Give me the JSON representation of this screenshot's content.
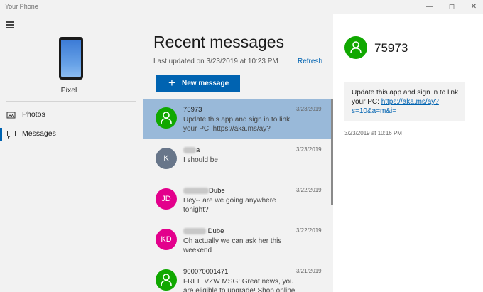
{
  "window": {
    "title": "Your Phone",
    "controls": [
      "minimize",
      "maximize",
      "close"
    ]
  },
  "sidebar": {
    "device_name": "Pixel",
    "nav": [
      {
        "label": "Photos",
        "icon": "photos-icon",
        "selected": false
      },
      {
        "label": "Messages",
        "icon": "messages-icon",
        "selected": true
      }
    ]
  },
  "messages": {
    "title": "Recent messages",
    "last_updated": "Last updated on 3/23/2019 at 10:23 PM",
    "refresh_label": "Refresh",
    "new_message_label": "New message",
    "conversations": [
      {
        "name": "75973",
        "preview": "Update this app and sign in to link your PC: https://aka.ms/ay?s=10&a-",
        "date": "3/23/2019",
        "avatar": "person-icon",
        "avatar_color": "#10a800",
        "selected": true
      },
      {
        "name": "a",
        "preview": "I should be",
        "date": "3/23/2019",
        "avatar": "K",
        "avatar_color": "#68768a",
        "selected": false
      },
      {
        "name": "Dube",
        "preview": "Hey-- are we going anywhere tonight?",
        "date": "3/22/2019",
        "avatar": "JD",
        "avatar_color": "#e3008c",
        "selected": false
      },
      {
        "name": "Dube",
        "preview": "Oh actually we can ask her this weekend",
        "date": "3/22/2019",
        "avatar": "KD",
        "avatar_color": "#e3008c",
        "selected": false
      },
      {
        "name": "900070001471",
        "preview": "FREE VZW MSG: Great news, you are eligible to upgrade! Shop online",
        "date": "3/21/2019",
        "avatar": "person-icon",
        "avatar_color": "#10a800",
        "selected": false
      }
    ]
  },
  "detail": {
    "contact_name": "75973",
    "message_text": "Update this app and sign in to link your PC: ",
    "message_link": "https://aka.ms/ay?s=10&a=m&i=",
    "timestamp": "3/23/2019 at 10:16 PM"
  },
  "colors": {
    "accent": "#0063b1",
    "selected_row": "#99b9d9",
    "green_avatar": "#10a800",
    "pink_avatar": "#e3008c",
    "gray_avatar": "#68768a"
  }
}
